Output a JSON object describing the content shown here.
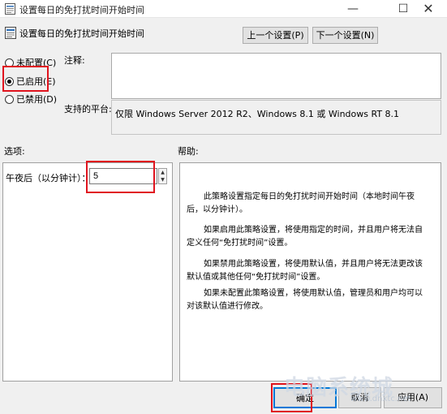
{
  "window": {
    "title": "设置每日的免打扰时间开始时间",
    "minimize": "—",
    "maximize": "☐",
    "close": "✕"
  },
  "header": {
    "title": "设置每日的免打扰时间开始时间",
    "prev_button": "上一个设置(P)",
    "next_button": "下一个设置(N)"
  },
  "state": {
    "options": [
      {
        "label": "未配置(C)",
        "checked": false
      },
      {
        "label": "已启用(E)",
        "checked": true
      },
      {
        "label": "已禁用(D)",
        "checked": false
      }
    ]
  },
  "comment": {
    "label": "注释:",
    "value": ""
  },
  "platform": {
    "label": "支持的平台:",
    "value": "仅限 Windows Server 2012 R2、Windows 8.1 或 Windows RT 8.1"
  },
  "options_section": {
    "label": "选项:",
    "field_label": "午夜后（以分钟计）：",
    "field_value": "5"
  },
  "help_section": {
    "label": "帮助:",
    "paragraphs": [
      "此策略设置指定每日的免打扰时间开始时间（本地时间午夜后，以分钟计）。",
      "如果启用此策略设置，将使用指定的时间，并且用户将无法自定义任何“免打扰时间”设置。",
      "如果禁用此策略设置，将使用默认值，并且用户将无法更改该默认值或其他任何“免打扰时间”设置。",
      "如果未配置此策略设置，将使用默认值，管理员和用户均可以对该默认值进行修改。"
    ]
  },
  "footer": {
    "ok": "确定",
    "cancel": "取消",
    "apply": "应用(A)"
  },
  "watermark": {
    "text": "电脑系统城",
    "url": "www.dnxtc.net"
  },
  "colors": {
    "highlight": "#e0141e",
    "focus": "#0078d7"
  }
}
